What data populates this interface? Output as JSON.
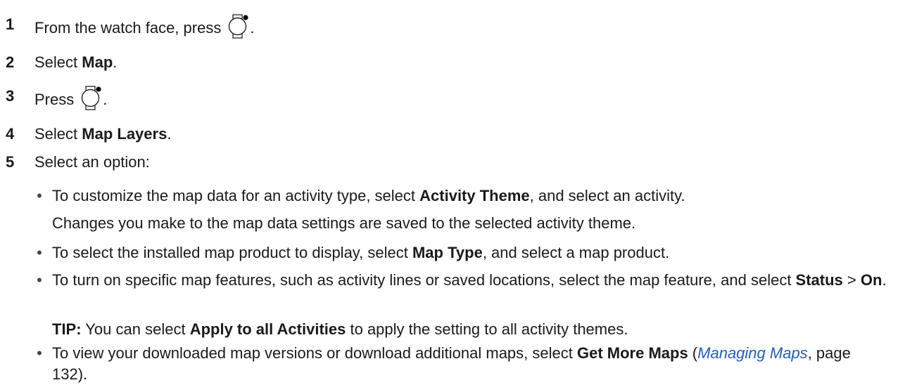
{
  "steps": [
    {
      "num": "1",
      "pre": "From the watch face, press",
      "post": ".",
      "icon": "watch-button-icon"
    },
    {
      "num": "2",
      "pre": "Select ",
      "bold": "Map",
      "post": "."
    },
    {
      "num": "3",
      "pre": "Press",
      "post": ".",
      "icon": "watch-button-icon"
    },
    {
      "num": "4",
      "pre": "Select ",
      "bold": "Map Layers",
      "post": "."
    },
    {
      "num": "5",
      "pre": "Select an option:"
    }
  ],
  "options": [
    {
      "bullet": "•",
      "line1": {
        "pre": "To customize the map data for an activity type, select ",
        "bold": "Activity Theme",
        "post": ", and select an activity."
      },
      "note": "Changes you make to the map data settings are saved to the selected activity theme."
    },
    {
      "bullet": "•",
      "line1": {
        "pre": "To select the installed map product to display, select ",
        "bold": "Map Type",
        "post": ", and select a map product."
      }
    },
    {
      "bullet": "•",
      "line1": {
        "pre": "To turn on specific map features, such as activity lines or saved locations, select the map feature, and select ",
        "bold": "Status",
        "mid": " > ",
        "bold2": "On",
        "post": "."
      },
      "tip": {
        "label": "TIP:",
        "pre": " You can select ",
        "bold": "Apply to all Activities",
        "post": " to apply the setting to all activity themes."
      }
    },
    {
      "bullet": "•",
      "line1": {
        "pre": "To view your downloaded map versions or download additional maps, select ",
        "bold": "Get More Maps",
        "mid": " (",
        "link": "Managing Maps",
        "link_suffix": ", page 132",
        "post": ")."
      }
    }
  ]
}
